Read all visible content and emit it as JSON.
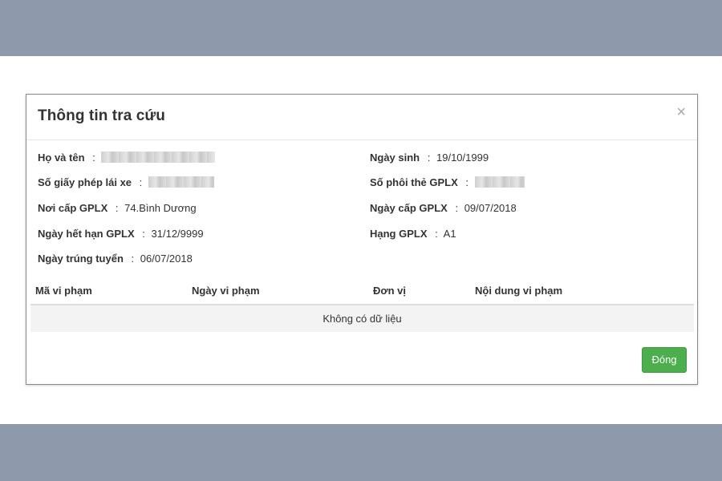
{
  "modal": {
    "title": "Thông tin tra cứu",
    "close_glyph": "×",
    "close_button_label": "Đóng"
  },
  "fields": {
    "ho_va_ten": {
      "label": "Họ và tên",
      "value": ""
    },
    "ngay_sinh": {
      "label": "Ngày sinh",
      "value": "19/10/1999"
    },
    "so_giay_phep": {
      "label": "Số giấy phép lái xe",
      "value": ""
    },
    "so_phoi_the": {
      "label": "Số phôi thẻ GPLX",
      "value": ""
    },
    "noi_cap": {
      "label": "Nơi cấp GPLX",
      "value": "74.Bình Dương"
    },
    "ngay_cap": {
      "label": "Ngày cấp GPLX",
      "value": "09/07/2018"
    },
    "ngay_het_han": {
      "label": "Ngày hết hạn GPLX",
      "value": "31/12/9999"
    },
    "hang": {
      "label": "Hạng GPLX",
      "value": "A1"
    },
    "ngay_trung_tuyen": {
      "label": "Ngày trúng tuyển",
      "value": "06/07/2018"
    }
  },
  "separator": ":",
  "table": {
    "columns": [
      "Mã vi phạm",
      "Ngày vi phạm",
      "Đơn vị",
      "Nội dung vi phạm"
    ],
    "empty_message": "Không có dữ liệu"
  },
  "colors": {
    "background_band": "#8e99ab",
    "primary_green": "#4cae4c",
    "empty_row_bg": "#f3f3f3"
  }
}
